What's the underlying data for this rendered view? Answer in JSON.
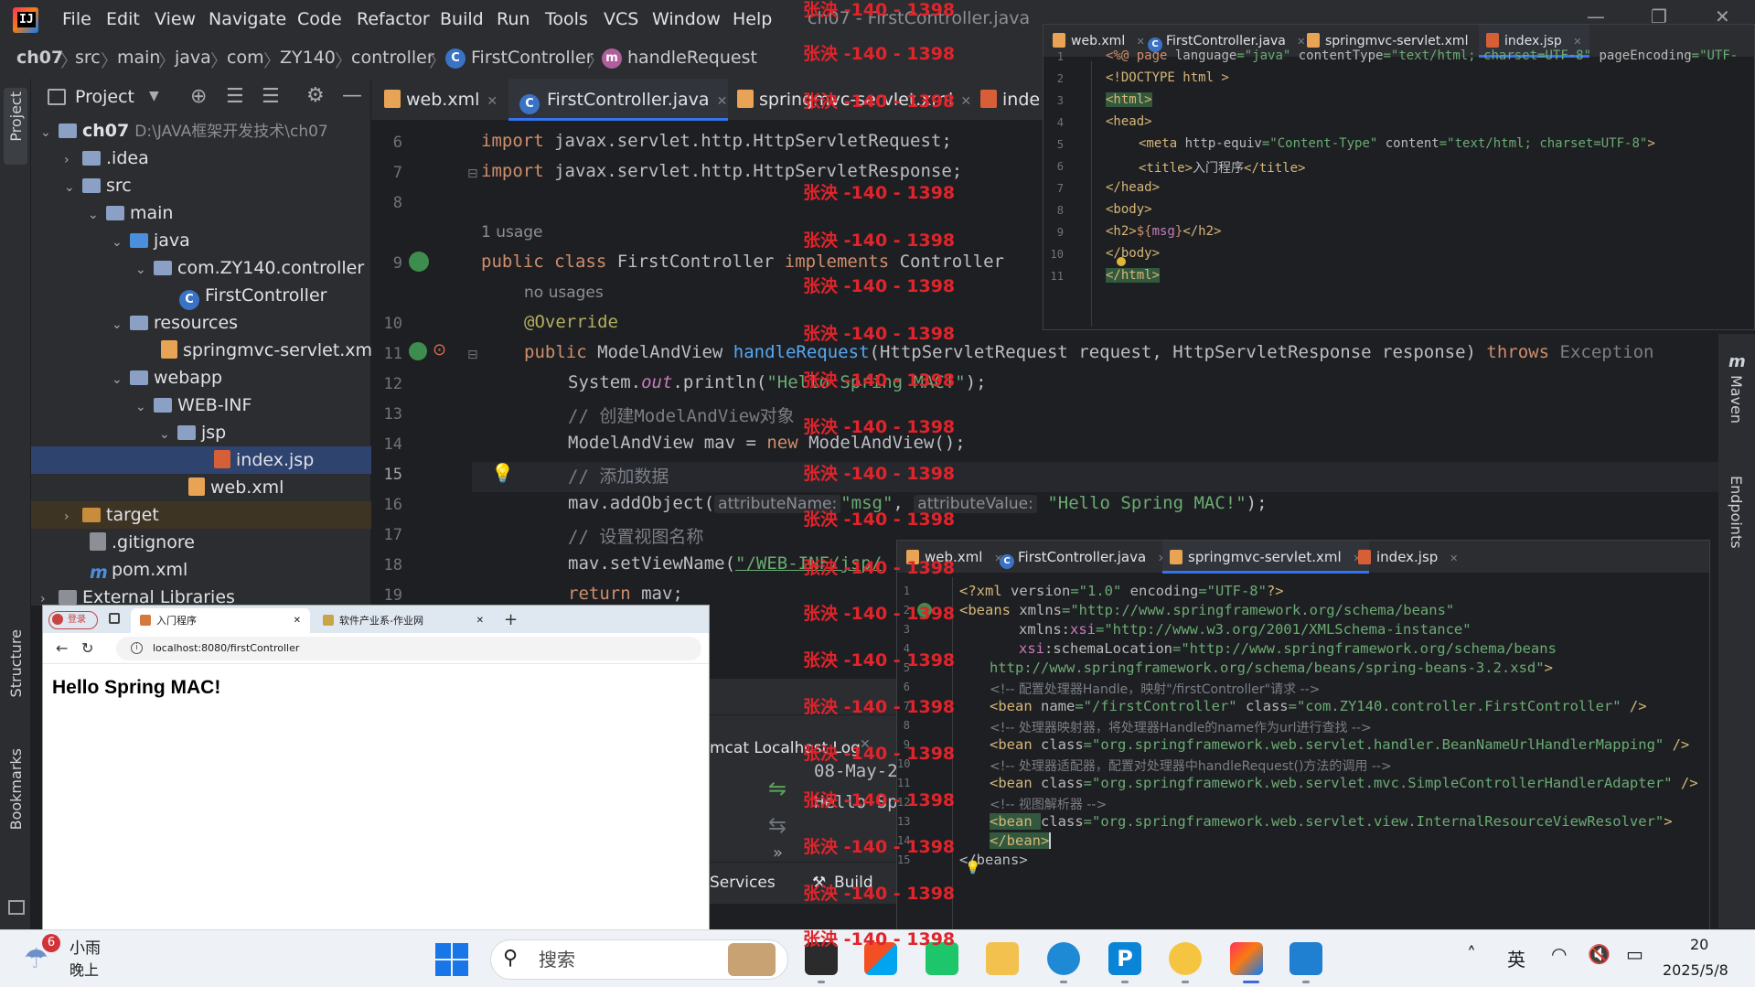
{
  "menubar": {
    "items": [
      "File",
      "Edit",
      "View",
      "Navigate",
      "Code",
      "Refactor",
      "Build",
      "Run",
      "Tools",
      "VCS",
      "Window",
      "Help"
    ],
    "window_title": "ch07 - FirstController.java"
  },
  "breadcrumb": [
    "ch07",
    "src",
    "main",
    "java",
    "com",
    "ZY140",
    "controller",
    "FirstController",
    "handleRequest"
  ],
  "project": {
    "title": "Project",
    "root": "ch07",
    "root_path": "D:\\JAVA框架开发技术\\ch07",
    "items": [
      ".idea",
      "src",
      "main",
      "java",
      "com.ZY140.controller",
      "FirstController",
      "resources",
      "springmvc-servlet.xml",
      "webapp",
      "WEB-INF",
      "jsp",
      "index.jsp",
      "web.xml",
      "target",
      ".gitignore",
      "pom.xml",
      "External Libraries"
    ]
  },
  "left_stripe": [
    "Project",
    "Structure",
    "Bookmarks"
  ],
  "right_stripe": [
    "Maven",
    "Endpoints"
  ],
  "editor": {
    "tabs": [
      "web.xml",
      "FirstController.java",
      "springmvc-servlet.xml",
      "inde"
    ],
    "line_numbers": [
      "6",
      "7",
      "8",
      "9",
      "10",
      "11",
      "12",
      "13",
      "14",
      "15",
      "16",
      "17",
      "18",
      "19"
    ],
    "usage_1": "1 usage",
    "usage_2": "no usages",
    "l6a": "import ",
    "l6b": "javax.servlet.http.HttpServletRequest;",
    "l7a": "import ",
    "l7b": "javax.servlet.http.HttpServletResponse;",
    "l9a": "public class ",
    "l9b": "FirstController ",
    "l9c": "implements ",
    "l9d": "Controller",
    "l10": "@Override",
    "l11a": "public ",
    "l11b": "ModelAndView ",
    "l11c": "handleRequest",
    "l11d": "(HttpServletRequest request, HttpServletResponse response) ",
    "l11e": "throws ",
    "l11f": "Exception",
    "l12a": "System.",
    "l12b": "out",
    "l12c": ".println(",
    "l12d": "\"Hello Spring MAC!\"",
    "l12e": ");",
    "l13": "// 创建ModelAndView对象",
    "l14a": "ModelAndView mav = ",
    "l14b": "new ",
    "l14c": "ModelAndView();",
    "l15": "// 添加数据",
    "l16a": "mav.addObject(",
    "l16b": "attributeName:",
    "l16c": "\"msg\"",
    "l16d": ", ",
    "l16e": "attributeValue:",
    "l16f": "\"Hello Spring MAC!\"",
    "l16g": ");",
    "l17": "// 设置视图名称",
    "l18a": "mav.setViewName(",
    "l18b": "\"/WEB-INF/jsp/",
    "l19a": "return ",
    "l19b": "mav;"
  },
  "watermark": "张泱 -140 - 1398",
  "jsp_window": {
    "tabs": [
      "web.xml",
      "FirstController.java",
      "springmvc-servlet.xml",
      "index.jsp"
    ],
    "line_numbers": [
      "1",
      "2",
      "3",
      "4",
      "5",
      "6",
      "7",
      "8",
      "9",
      "10",
      "11"
    ],
    "l1a": "<%@ ",
    "l1b": "page ",
    "l1c": "language",
    "l1d": "=\"java\" ",
    "l1e": "contentType",
    "l1f": "=\"text/html; charset=UTF-8\" ",
    "l1g": "pageEncoding",
    "l1h": "=\"UTF-",
    "l2": "<!DOCTYPE html >",
    "l3": "<html>",
    "l4": "<head>",
    "l5a": "<meta ",
    "l5b": "http-equiv",
    "l5c": "=\"Content-Type\" ",
    "l5d": "content",
    "l5e": "=\"text/html; charset=UTF-8\"",
    "l5f": ">",
    "l6a": "<title>",
    "l6b": "入门程序",
    "l6c": "</title>",
    "l7": "</head>",
    "l8": "<body>",
    "l9a": "<h2>",
    "l9b": "${",
    "l9c": "msg",
    "l9d": "}",
    "l9e": "</h2>",
    "l10": "</body>",
    "l11": "</html>"
  },
  "xml_window": {
    "tabs": [
      "web.xml",
      "FirstController.java",
      "springmvc-servlet.xml",
      "index.jsp"
    ],
    "line_numbers": [
      "1",
      "2",
      "3",
      "4",
      "5",
      "6",
      "7",
      "8",
      "9",
      "10",
      "11",
      "12",
      "13",
      "14",
      "15"
    ],
    "l1a": "<?xml ",
    "l1b": "version",
    "l1c": "=\"1.0\" ",
    "l1d": "encoding",
    "l1e": "=\"UTF-8\"",
    "l1f": "?>",
    "l2a": "<beans ",
    "l2b": "xmlns",
    "l2c": "=\"http://www.springframework.org/schema/beans\"",
    "l3a": "xmlns:",
    "l3b": "xsi",
    "l3c": "=\"http://www.w3.org/2001/XMLSchema-instance\"",
    "l4a": "xsi",
    "l4b": ":schemaLocation",
    "l4c": "=\"http://www.springframework.org/schema/beans",
    "l5": "http://www.springframework.org/schema/beans/spring-beans-3.2.xsd\"",
    "l5b": ">",
    "l6": "<!-- 配置处理器Handle，映射\"/firstController\"请求 -->",
    "l7a": "<bean ",
    "l7b": "name",
    "l7c": "=\"/firstController\" ",
    "l7d": "class",
    "l7e": "=\"com.ZY140.controller.FirstController\" ",
    "l7f": "/>",
    "l8": "<!-- 处理器映射器，将处理器Handle的name作为url进行查找 -->",
    "l9a": "<bean ",
    "l9b": "class",
    "l9c": "=\"org.springframework.web.servlet.handler.BeanNameUrlHandlerMapping\" ",
    "l9d": "/>",
    "l10": "<!-- 处理器适配器，配置对处理器中handleRequest()方法的调用 -->",
    "l11a": "<bean ",
    "l11b": "class",
    "l11c": "=\"org.springframework.web.servlet.mvc.SimpleControllerHandlerAdapter\" ",
    "l11d": "/>",
    "l12": "<!-- 视图解析器 -->",
    "l13a": "<bean ",
    "l13b": "class",
    "l13c": "=\"org.springframework.web.servlet.view.InternalResourceViewResolver\"",
    "l13d": ">",
    "l14": "</bean>",
    "l15": "</beans>"
  },
  "run_panel": {
    "tab": "mcat Localhost Log",
    "log_1": "08-May-2",
    "log_2": "Hello Sp",
    "services": "Services",
    "build": "Build"
  },
  "browser": {
    "profile": "登录",
    "tab_active": "入门程序",
    "tab_2": "软件产业系-作业网",
    "new_tab": "+",
    "url": "localhost:8080/firstController",
    "heading": "Hello Spring MAC!"
  },
  "taskbar": {
    "weather_badge": "6",
    "weather_line1": "小雨",
    "weather_line2": "晚上",
    "search_placeholder": "搜索",
    "ime": "英",
    "clock_time": "20",
    "clock_date": "2025/5/8"
  },
  "colors": {
    "ide_bg": "#1e1f22",
    "panel_bg": "#2b2d30",
    "accent": "#3574f0",
    "watermark": "#e0242b",
    "selection": "#2e436e"
  }
}
